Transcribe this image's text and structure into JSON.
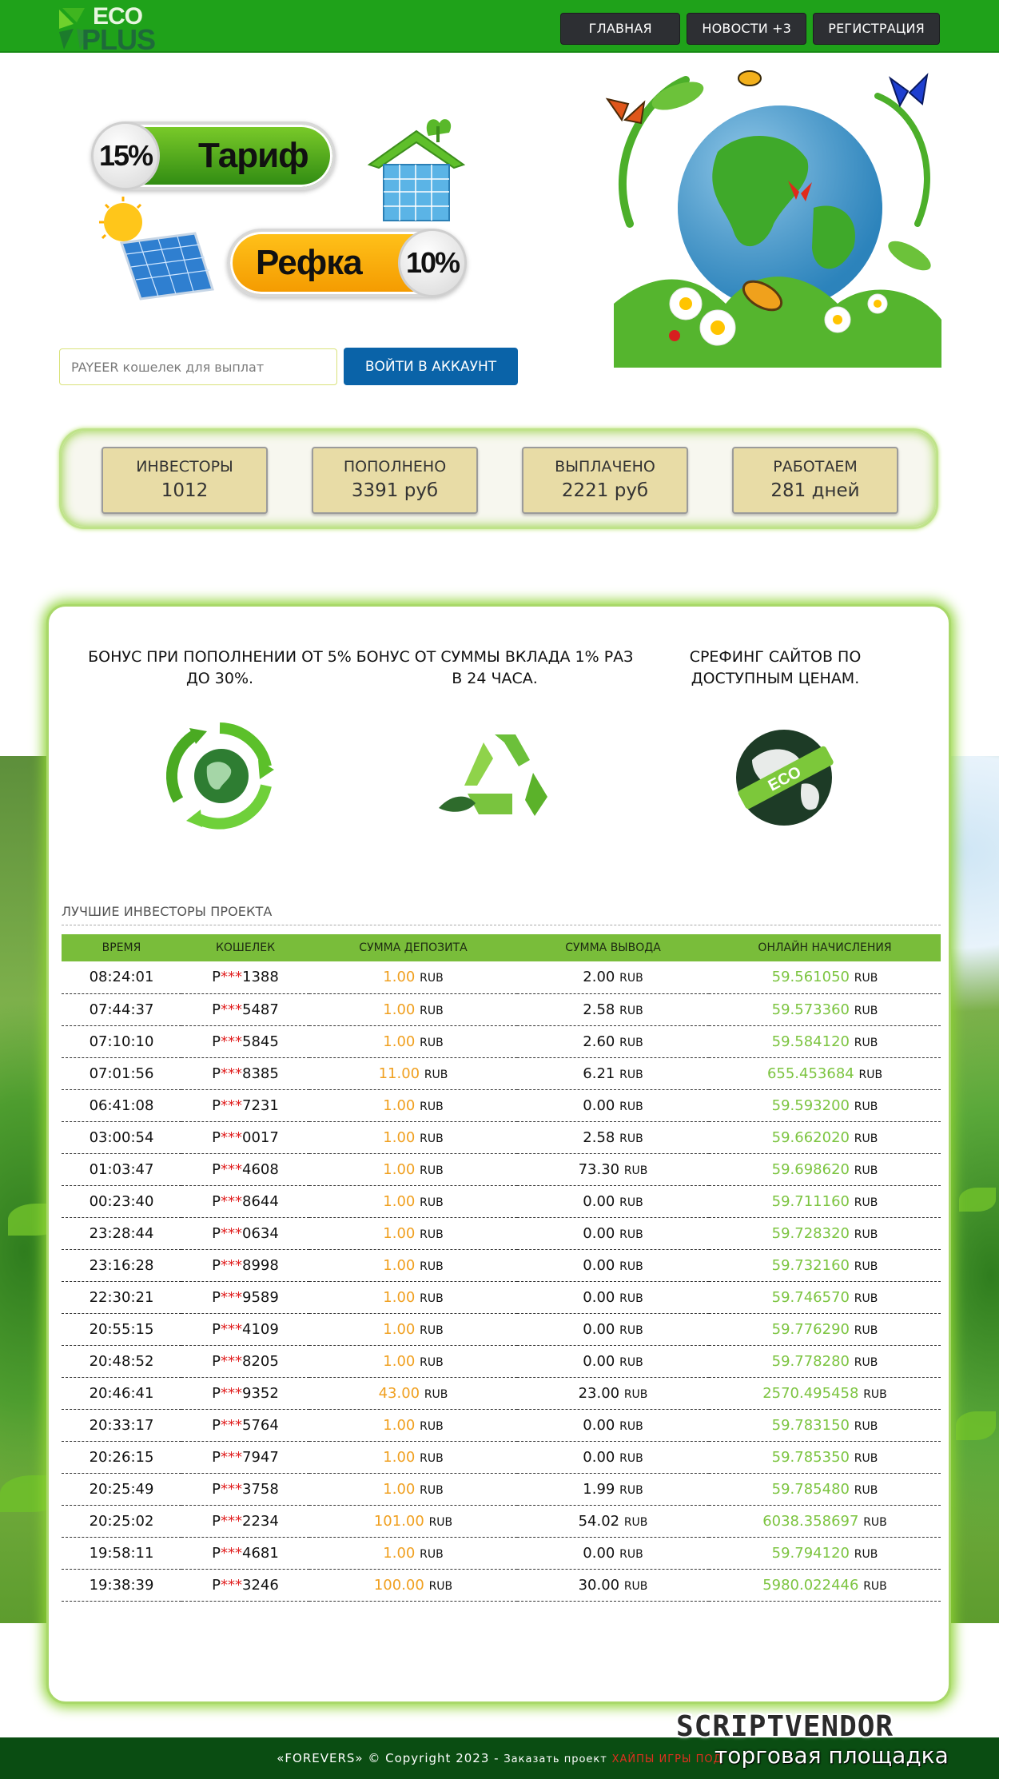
{
  "header": {
    "logo": {
      "line1": "ECO",
      "line2": "PLUS"
    },
    "nav": [
      {
        "label": "ГЛАВНАЯ"
      },
      {
        "label": "НОВОСТИ +3"
      },
      {
        "label": "РЕГИСТРАЦИЯ"
      }
    ]
  },
  "hero": {
    "tariff": {
      "percent": "15%",
      "label": "Тариф"
    },
    "referral": {
      "label": "Рефка",
      "percent": "10%"
    }
  },
  "login": {
    "placeholder": "PAYEER кошелек для выплат",
    "button": "ВОЙТИ В АККАУНТ"
  },
  "stats": [
    {
      "label": "ИНВЕСТОРЫ",
      "value": "1012"
    },
    {
      "label": "ПОПОЛНЕНО",
      "value": "3391 руб"
    },
    {
      "label": "ВЫПЛАЧЕНО",
      "value": "2221 руб"
    },
    {
      "label": "РАБОТАЕМ",
      "value": "281 дней"
    }
  ],
  "features": [
    {
      "text": "БОНУС ПРИ ПОПОЛНЕНИИ ОТ 5% ДО 30%.",
      "icon": "globe-arrows-icon"
    },
    {
      "text": "БОНУС ОТ СУММЫ ВКЛАДА 1% РАЗ В 24 ЧАСА.",
      "icon": "recycle-icon"
    },
    {
      "text": "СРЕФИНГ САЙТОВ ПО ДОСТУПНЫМ ЦЕНАМ.",
      "icon": "eco-globe-icon"
    }
  ],
  "investors": {
    "title": "ЛУЧШИЕ ИНВЕСТОРЫ ПРОЕКТА",
    "columns": [
      "ВРЕМЯ",
      "КОШЕЛЕК",
      "СУММА ДЕПОЗИТА",
      "СУММА ВЫВОДА",
      "ОНЛАЙН НАЧИСЛЕНИЯ"
    ],
    "wallet_prefix": "P",
    "wallet_mask": "***",
    "unit": "RUB",
    "rows": [
      {
        "time": "08:24:01",
        "wallet": "1388",
        "deposit": "1.00",
        "withdraw": "2.00",
        "accrual": "59.561050"
      },
      {
        "time": "07:44:37",
        "wallet": "5487",
        "deposit": "1.00",
        "withdraw": "2.58",
        "accrual": "59.573360"
      },
      {
        "time": "07:10:10",
        "wallet": "5845",
        "deposit": "1.00",
        "withdraw": "2.60",
        "accrual": "59.584120"
      },
      {
        "time": "07:01:56",
        "wallet": "8385",
        "deposit": "11.00",
        "withdraw": "6.21",
        "accrual": "655.453684"
      },
      {
        "time": "06:41:08",
        "wallet": "7231",
        "deposit": "1.00",
        "withdraw": "0.00",
        "accrual": "59.593200"
      },
      {
        "time": "03:00:54",
        "wallet": "0017",
        "deposit": "1.00",
        "withdraw": "2.58",
        "accrual": "59.662020"
      },
      {
        "time": "01:03:47",
        "wallet": "4608",
        "deposit": "1.00",
        "withdraw": "73.30",
        "accrual": "59.698620"
      },
      {
        "time": "00:23:40",
        "wallet": "8644",
        "deposit": "1.00",
        "withdraw": "0.00",
        "accrual": "59.711160"
      },
      {
        "time": "23:28:44",
        "wallet": "0634",
        "deposit": "1.00",
        "withdraw": "0.00",
        "accrual": "59.728320"
      },
      {
        "time": "23:16:28",
        "wallet": "8998",
        "deposit": "1.00",
        "withdraw": "0.00",
        "accrual": "59.732160"
      },
      {
        "time": "22:30:21",
        "wallet": "9589",
        "deposit": "1.00",
        "withdraw": "0.00",
        "accrual": "59.746570"
      },
      {
        "time": "20:55:15",
        "wallet": "4109",
        "deposit": "1.00",
        "withdraw": "0.00",
        "accrual": "59.776290"
      },
      {
        "time": "20:48:52",
        "wallet": "8205",
        "deposit": "1.00",
        "withdraw": "0.00",
        "accrual": "59.778280"
      },
      {
        "time": "20:46:41",
        "wallet": "9352",
        "deposit": "43.00",
        "withdraw": "23.00",
        "accrual": "2570.495458"
      },
      {
        "time": "20:33:17",
        "wallet": "5764",
        "deposit": "1.00",
        "withdraw": "0.00",
        "accrual": "59.783150"
      },
      {
        "time": "20:26:15",
        "wallet": "7947",
        "deposit": "1.00",
        "withdraw": "0.00",
        "accrual": "59.785350"
      },
      {
        "time": "20:25:49",
        "wallet": "3758",
        "deposit": "1.00",
        "withdraw": "1.99",
        "accrual": "59.785480"
      },
      {
        "time": "20:25:02",
        "wallet": "2234",
        "deposit": "101.00",
        "withdraw": "54.02",
        "accrual": "6038.358697"
      },
      {
        "time": "19:58:11",
        "wallet": "4681",
        "deposit": "1.00",
        "withdraw": "0.00",
        "accrual": "59.794120"
      },
      {
        "time": "19:38:39",
        "wallet": "3246",
        "deposit": "100.00",
        "withdraw": "30.00",
        "accrual": "5980.022446"
      }
    ]
  },
  "footer": {
    "copyright": "«FOREVERS» © Copyright 2023 -",
    "order_text": "Заказать проект",
    "order_link": "ХАЙПЫ ИГРЫ ПОД"
  },
  "watermark": {
    "line1": "SCRIPTVENDOR",
    "line2": "торговая площадка"
  },
  "colors": {
    "header_green": "#1fa21a",
    "nav_dark": "#2d2f33",
    "login_blue": "#0a63a8",
    "table_head_green": "#79bd3a",
    "deposit_orange": "#f0a020",
    "accrual_green": "#7cc440",
    "wallet_star_red": "#e02020",
    "footer_green": "#0a4d12"
  }
}
